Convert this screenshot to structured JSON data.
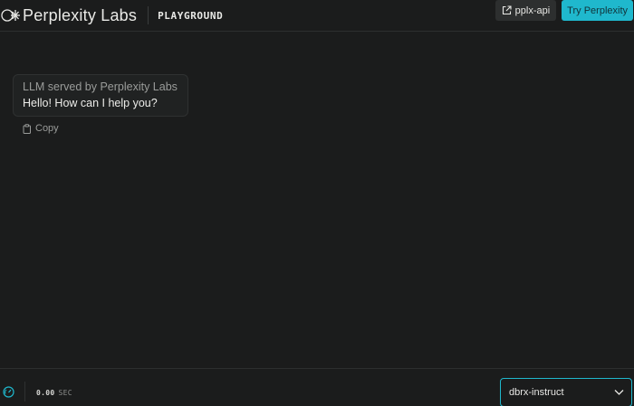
{
  "header": {
    "brand": "Perplexity Labs",
    "section": "PLAYGROUND",
    "api_button_label": "pplx-api",
    "try_button_label": "Try Perplexity"
  },
  "conversation": {
    "messages": [
      {
        "sender": "LLM served by Perplexity Labs",
        "text": "Hello! How can I help you?",
        "copy_label": "Copy"
      }
    ]
  },
  "footer": {
    "timer_value": "0.00",
    "timer_unit": "SEC",
    "model_selected": "dbrx-instruct"
  },
  "icons": {
    "logo": "perplexity-logo-icon",
    "api_link": "external-link-icon",
    "copy": "clipboard-icon",
    "speed": "gauge-icon",
    "dropdown": "chevron-down-icon"
  },
  "colors": {
    "background": "#1b1c1c",
    "accent": "#1fb8cd",
    "card": "#202222",
    "muted_text": "#9a9c9a"
  }
}
